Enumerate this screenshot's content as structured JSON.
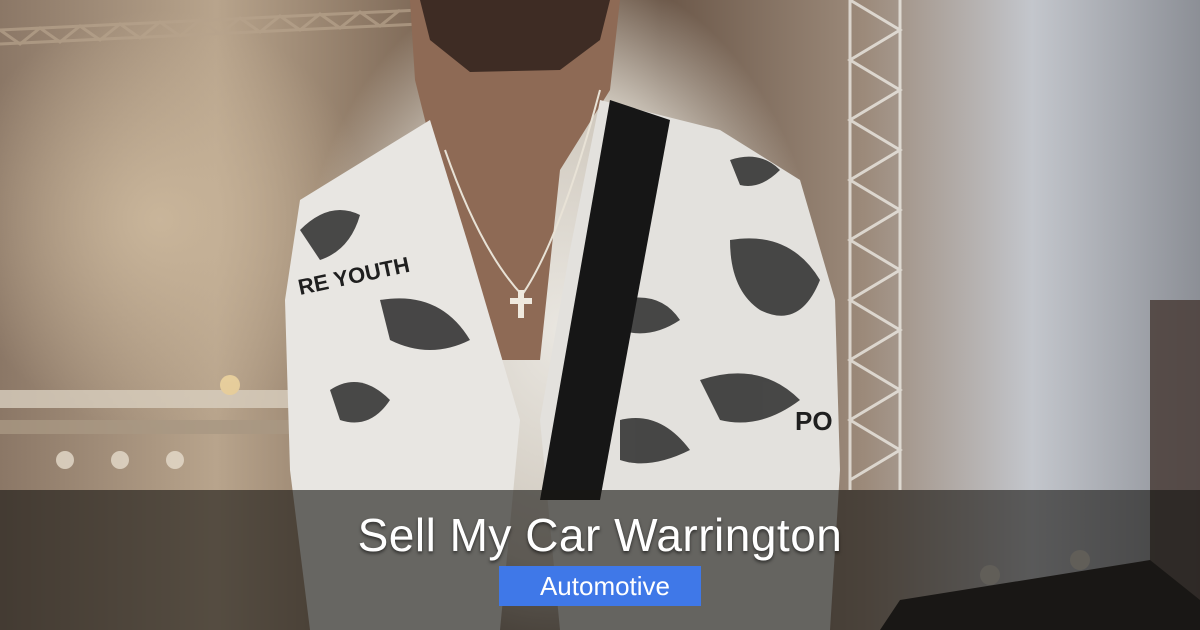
{
  "title": "Sell My Car Warrington",
  "category": {
    "label": "Automotive",
    "icon": "folder-icon",
    "icon_glyph": ""
  },
  "colors": {
    "badge_bg": "#3f78e8",
    "band_bg": "rgba(25,22,20,0.62)"
  },
  "photo": {
    "shirt_text_left": "RE YOUTH",
    "shirt_text_right": "PO"
  }
}
